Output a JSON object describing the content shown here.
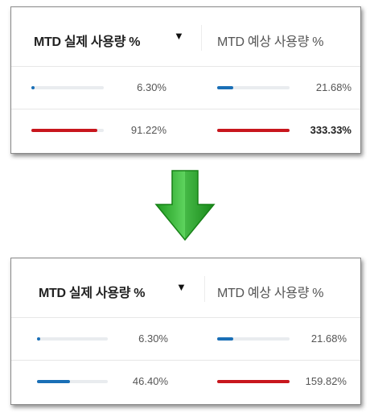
{
  "top_panel": {
    "header": {
      "col1_label": "MTD 실제 사용량 %",
      "sort_icon": "▼",
      "col2_label": "MTD 예상 사용량 %"
    },
    "rows": [
      {
        "actual_text": "6.30%",
        "actual_fraction": 0.063,
        "actual_color": "#1a6fb6",
        "forecast_text": "21.68%",
        "forecast_fraction": 0.2168,
        "forecast_color": "#1a6fb6"
      },
      {
        "actual_text": "91.22%",
        "actual_fraction": 0.9122,
        "actual_color": "#c8161d",
        "forecast_text": "333.33%",
        "forecast_fraction": 1.0,
        "forecast_color": "#c8161d"
      }
    ]
  },
  "arrow": {
    "icon": "green-down-arrow-icon",
    "color": "#2cb52c"
  },
  "bottom_panel": {
    "header": {
      "col1_label": "MTD 실제 사용량 %",
      "sort_icon": "▼",
      "col2_label": "MTD 예상 사용량 %"
    },
    "rows": [
      {
        "actual_text": "6.30%",
        "actual_fraction": 0.063,
        "actual_color": "#1a6fb6",
        "forecast_text": "21.68%",
        "forecast_fraction": 0.2168,
        "forecast_color": "#1a6fb6"
      },
      {
        "actual_text": "46.40%",
        "actual_fraction": 0.464,
        "actual_color": "#1a6fb6",
        "forecast_text": "159.82%",
        "forecast_fraction": 1.0,
        "forecast_color": "#c8161d"
      }
    ]
  }
}
